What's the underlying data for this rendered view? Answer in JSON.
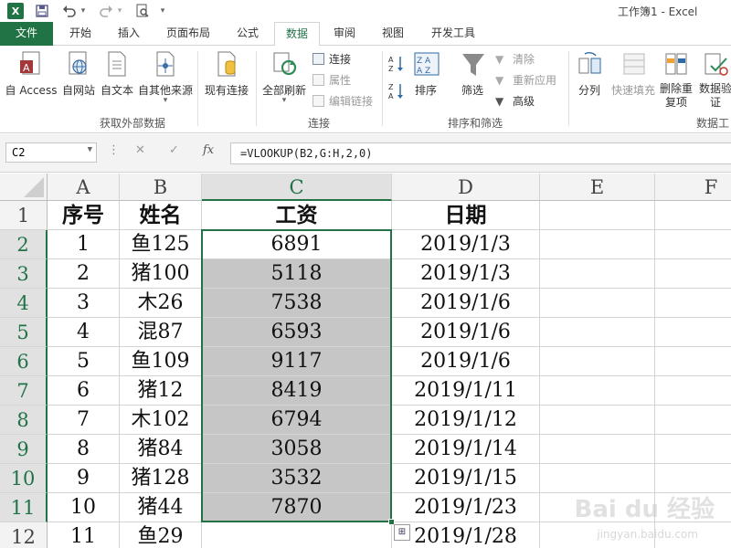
{
  "app": {
    "logo": "X",
    "window_title": "工作簿1 - Excel",
    "accent": "#217346"
  },
  "quick_access": {
    "save_icon": "save-icon",
    "undo_icon": "undo-icon",
    "redo_icon": "redo-icon",
    "print_preview_icon": "print-preview-icon",
    "customize_glyph": "▾"
  },
  "tabs": [
    {
      "label": "文件"
    },
    {
      "label": "开始"
    },
    {
      "label": "插入"
    },
    {
      "label": "页面布局"
    },
    {
      "label": "公式"
    },
    {
      "label": "数据"
    },
    {
      "label": "审阅"
    },
    {
      "label": "视图"
    },
    {
      "label": "开发工具"
    }
  ],
  "ribbon": {
    "get_external": {
      "group_label": "获取外部数据",
      "buttons": [
        "自 Access",
        "自网站",
        "自文本",
        "自其他来源"
      ],
      "existing": "现有连接"
    },
    "connections": {
      "group_label": "连接",
      "refresh_all": "全部刷新",
      "small": [
        "连接",
        "属性",
        "编辑链接"
      ]
    },
    "sort_filter": {
      "group_label": "排序和筛选",
      "sort": "排序",
      "filter": "筛选",
      "small": [
        "清除",
        "重新应用",
        "高级"
      ]
    },
    "data_tools": {
      "group_label": "数据工",
      "buttons": [
        "分列",
        "快速填充",
        "删除重复项",
        "数据验证"
      ]
    }
  },
  "formula_bar": {
    "name_box": "C2",
    "formula": "=VLOOKUP(B2,G:H,2,0)",
    "cancel_glyph": "✕",
    "enter_glyph": "✓",
    "fx_label": "fx"
  },
  "sheet": {
    "columns": [
      "A",
      "B",
      "C",
      "D",
      "E",
      "F"
    ],
    "rows": [
      "1",
      "2",
      "3",
      "4",
      "5",
      "6",
      "7",
      "8",
      "9",
      "10",
      "11",
      "12"
    ],
    "header": [
      "序号",
      "姓名",
      "工资",
      "日期"
    ],
    "data": [
      [
        "1",
        "鱼125",
        "6891",
        "2019/1/3"
      ],
      [
        "2",
        "猪100",
        "5118",
        "2019/1/3"
      ],
      [
        "3",
        "木26",
        "7538",
        "2019/1/6"
      ],
      [
        "4",
        "混87",
        "6593",
        "2019/1/6"
      ],
      [
        "5",
        "鱼109",
        "9117",
        "2019/1/6"
      ],
      [
        "6",
        "猪12",
        "8419",
        "2019/1/11"
      ],
      [
        "7",
        "木102",
        "6794",
        "2019/1/12"
      ],
      [
        "8",
        "猪84",
        "3058",
        "2019/1/14"
      ],
      [
        "9",
        "猪128",
        "3532",
        "2019/1/15"
      ],
      [
        "10",
        "猪44",
        "7870",
        "2019/1/23"
      ],
      [
        "11",
        "鱼29",
        "",
        "2019/1/28"
      ]
    ],
    "active_cell": "C2",
    "selection": "C2:C11"
  },
  "watermark": {
    "brand": "Bai du 经验",
    "url": "jingyan.baidu.com"
  }
}
